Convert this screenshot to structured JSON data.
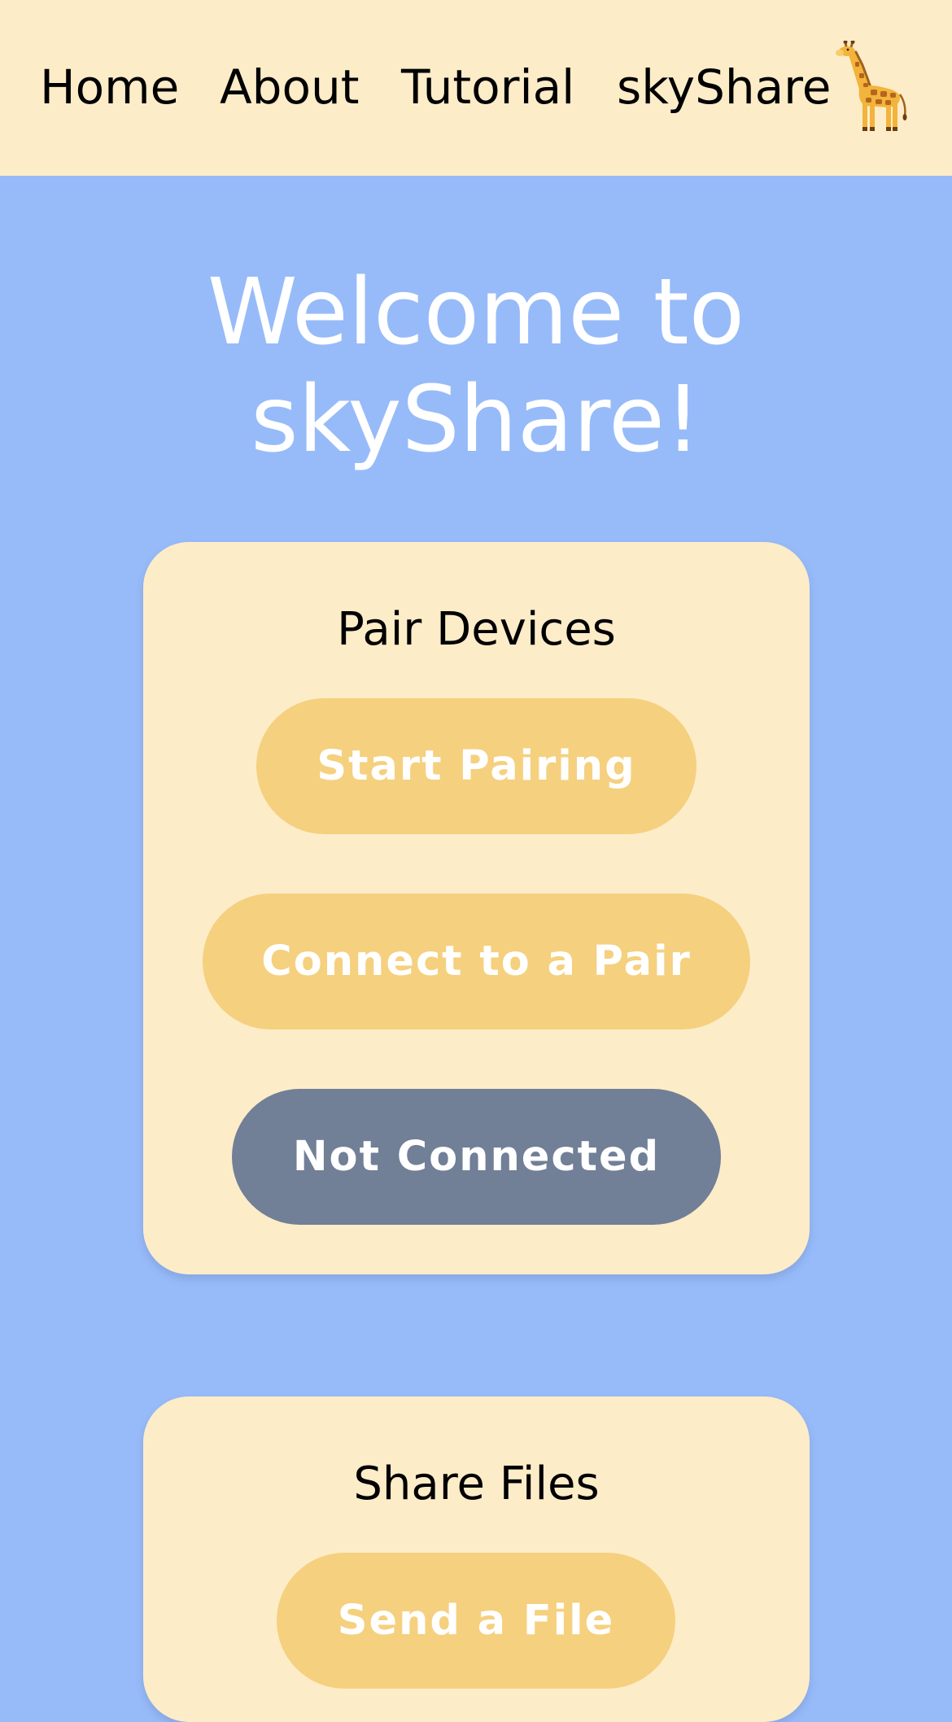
{
  "nav": {
    "home": "Home",
    "about": "About",
    "tutorial": "Tutorial",
    "brand": "skyShare",
    "brand_icon": "giraffe-icon"
  },
  "hero": {
    "title_line1": "Welcome to",
    "title_line2": "skyShare!"
  },
  "pair_card": {
    "title": "Pair Devices",
    "start_label": "Start Pairing",
    "connect_label": "Connect to a Pair",
    "status_label": "Not Connected"
  },
  "share_card": {
    "title": "Share Files",
    "send_label": "Send a File"
  },
  "colors": {
    "background": "#97bbf9",
    "panel": "#fdecc8",
    "button": "#f5d07e",
    "status_button": "#717f97"
  }
}
